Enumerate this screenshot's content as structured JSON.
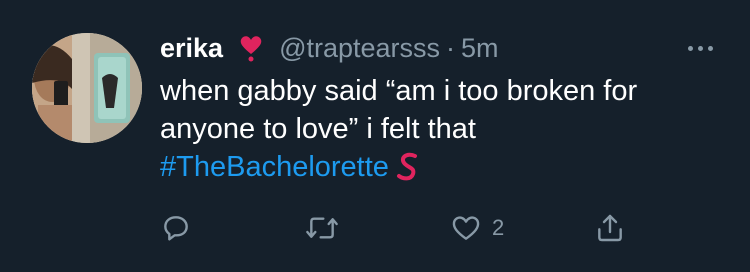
{
  "tweet": {
    "author": {
      "display_name": "erika",
      "name_emoji": "red-heart-exclamation-emoji",
      "handle": "@traptearsss",
      "separator": "·",
      "timestamp": "5m"
    },
    "text_lines": [
      "when gabby said “am i too broken for",
      "anyone to love” i felt that"
    ],
    "hashtag": "#TheBachelorette",
    "hashtag_emoji": "bachelorette-hashflag-emoji",
    "actions": {
      "reply": {
        "icon": "reply-icon",
        "count": ""
      },
      "retweet": {
        "icon": "retweet-icon",
        "count": ""
      },
      "like": {
        "icon": "heart-icon",
        "count": "2"
      },
      "share": {
        "icon": "share-icon",
        "count": ""
      }
    },
    "colors": {
      "background": "#15202b",
      "text": "#ffffff",
      "muted": "#8899a6",
      "link": "#1d9bf0"
    }
  }
}
